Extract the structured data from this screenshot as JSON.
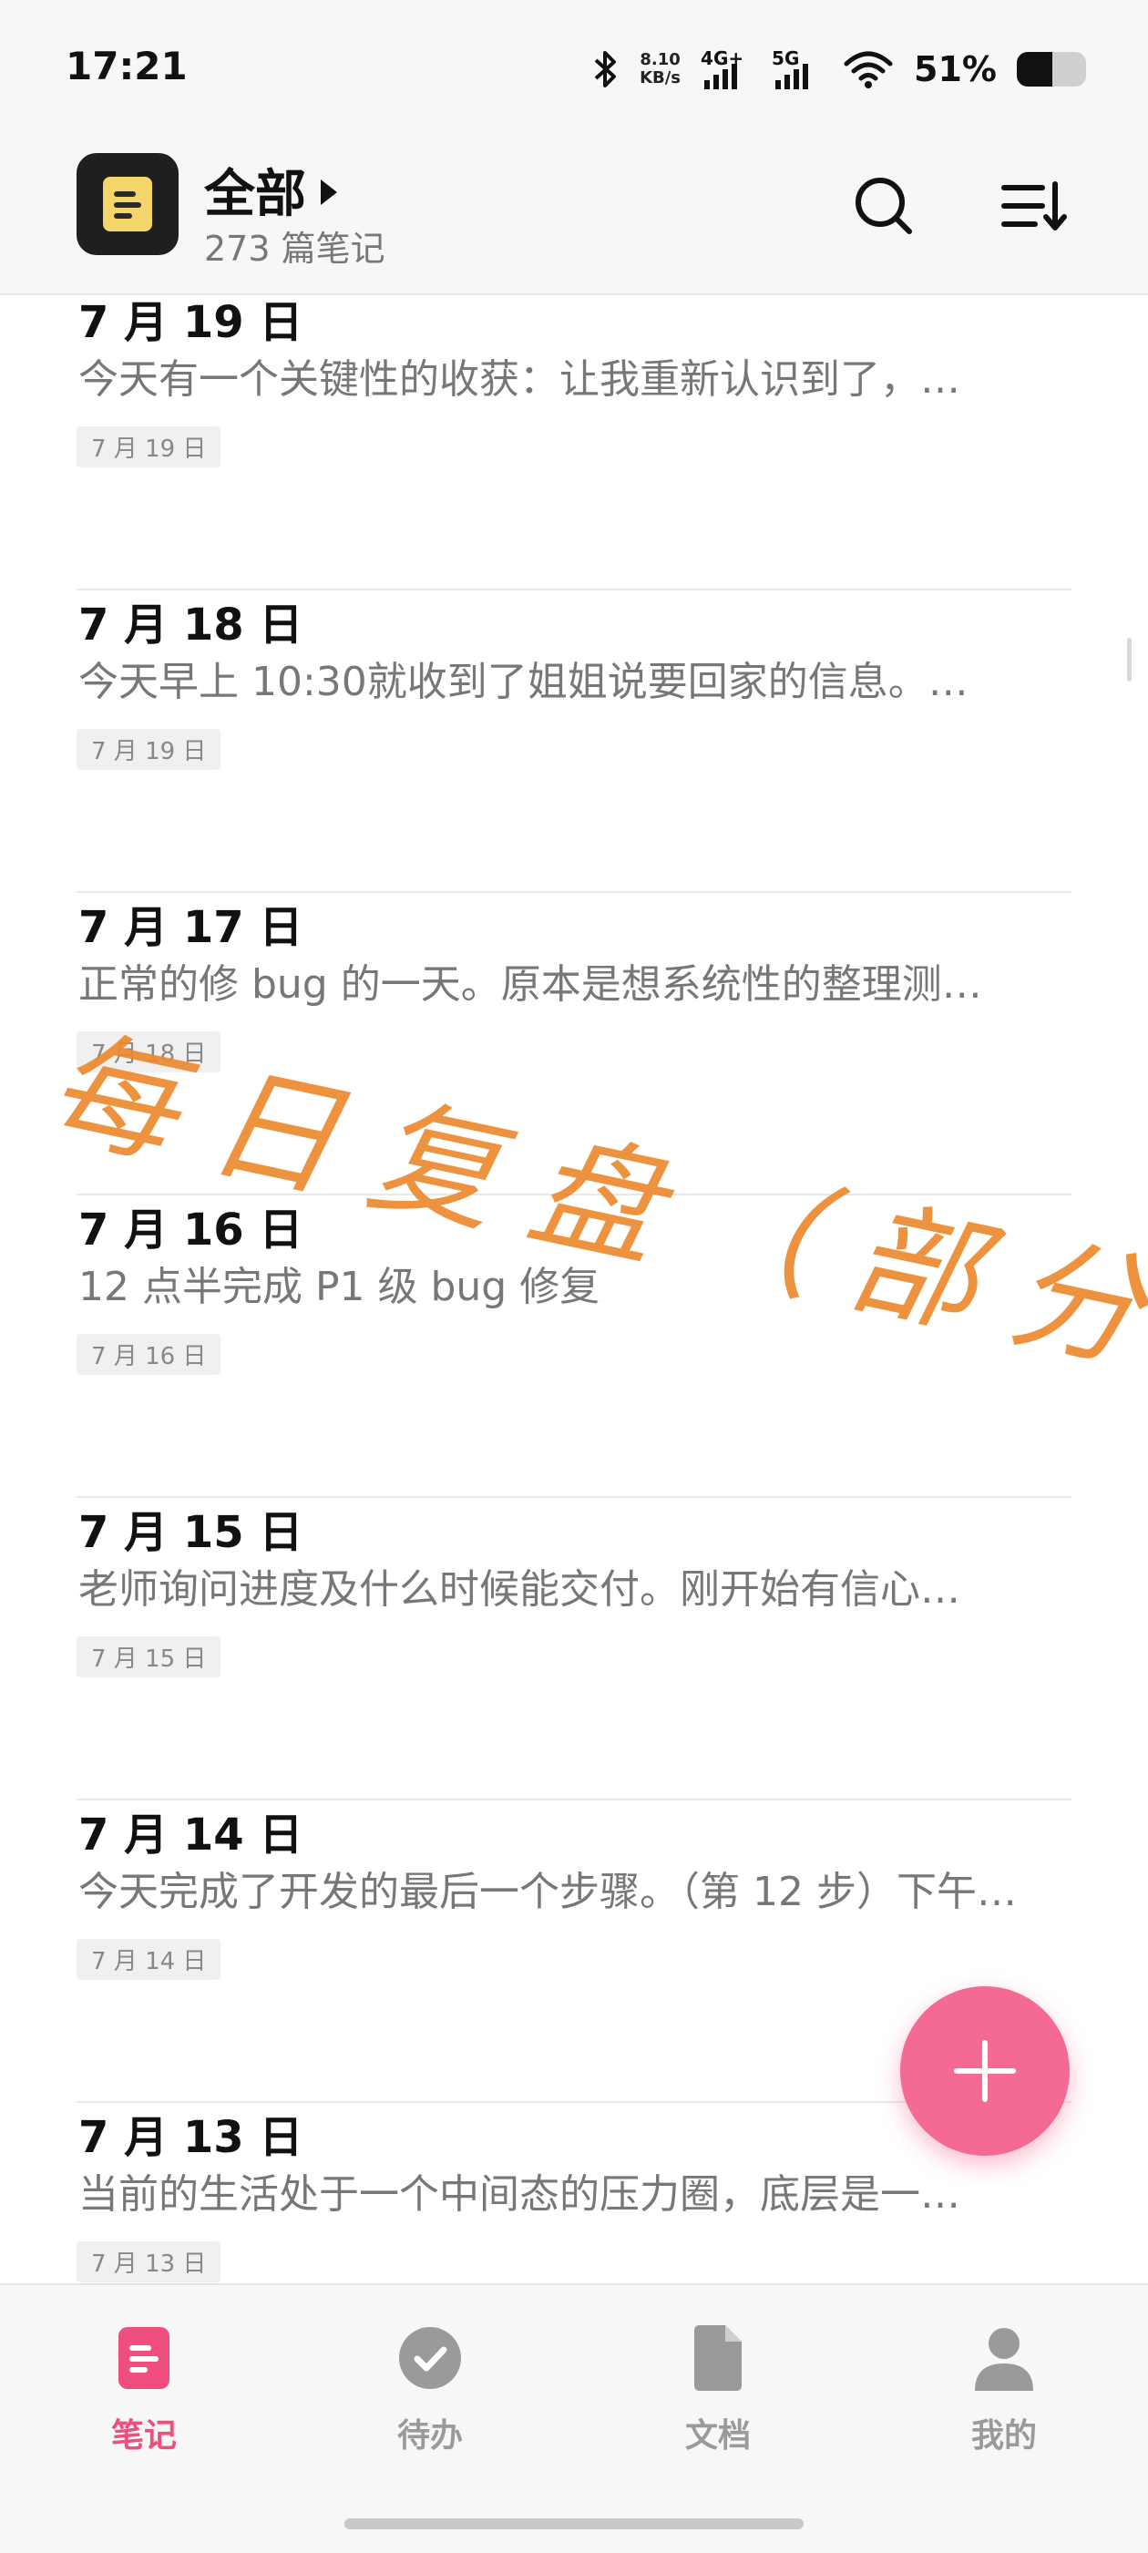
{
  "status_bar": {
    "time": "17:21",
    "net_speed_value": "8.10",
    "net_speed_unit": "KB/s",
    "signal_1_label": "4G+",
    "signal_2_label": "5G",
    "battery_percent": "51%",
    "battery_level": 0.51
  },
  "header": {
    "title": "全部",
    "subtitle": "273 篇笔记",
    "logo_icon": "note-icon",
    "search_icon": "search-icon",
    "sort_icon": "sort-icon"
  },
  "notes": [
    {
      "title": "7 月 19 日",
      "preview": "今天有一个关键性的收获：让我重新认识到了，…",
      "date": "7 月 19 日"
    },
    {
      "title": "7 月 18 日",
      "preview": "今天早上 10:30就收到了姐姐说要回家的信息。…",
      "date": "7 月 19 日"
    },
    {
      "title": "7 月 17 日",
      "preview": "正常的修 bug 的一天。原本是想系统性的整理测…",
      "date": "7 月 18 日"
    },
    {
      "title": "7 月 16 日",
      "preview": "12 点半完成 P1 级 bug 修复",
      "date": "7 月 16 日"
    },
    {
      "title": "7 月 15 日",
      "preview": "老师询问进度及什么时候能交付。刚开始有信心…",
      "date": "7 月 15 日"
    },
    {
      "title": "7 月 14 日",
      "preview": "今天完成了开发的最后一个步骤。（第 12 步）下午…",
      "date": "7 月 14 日"
    },
    {
      "title": "7 月 13 日",
      "preview": "当前的生活处于一个中间态的压力圈，底层是一…",
      "date": "7 月 13 日"
    }
  ],
  "overlay": {
    "text": "每日复盘（部分）",
    "color": "#ec8a2f"
  },
  "fab": {
    "icon": "plus-icon",
    "color": "#f56a93"
  },
  "bottom_nav": [
    {
      "label": "笔记",
      "icon": "notes-icon",
      "active": true
    },
    {
      "label": "待办",
      "icon": "check-circle-icon",
      "active": false
    },
    {
      "label": "文档",
      "icon": "document-icon",
      "active": false
    },
    {
      "label": "我的",
      "icon": "profile-icon",
      "active": false
    }
  ],
  "colors": {
    "accent": "#ef4f7f",
    "muted": "#9a9a9a"
  }
}
